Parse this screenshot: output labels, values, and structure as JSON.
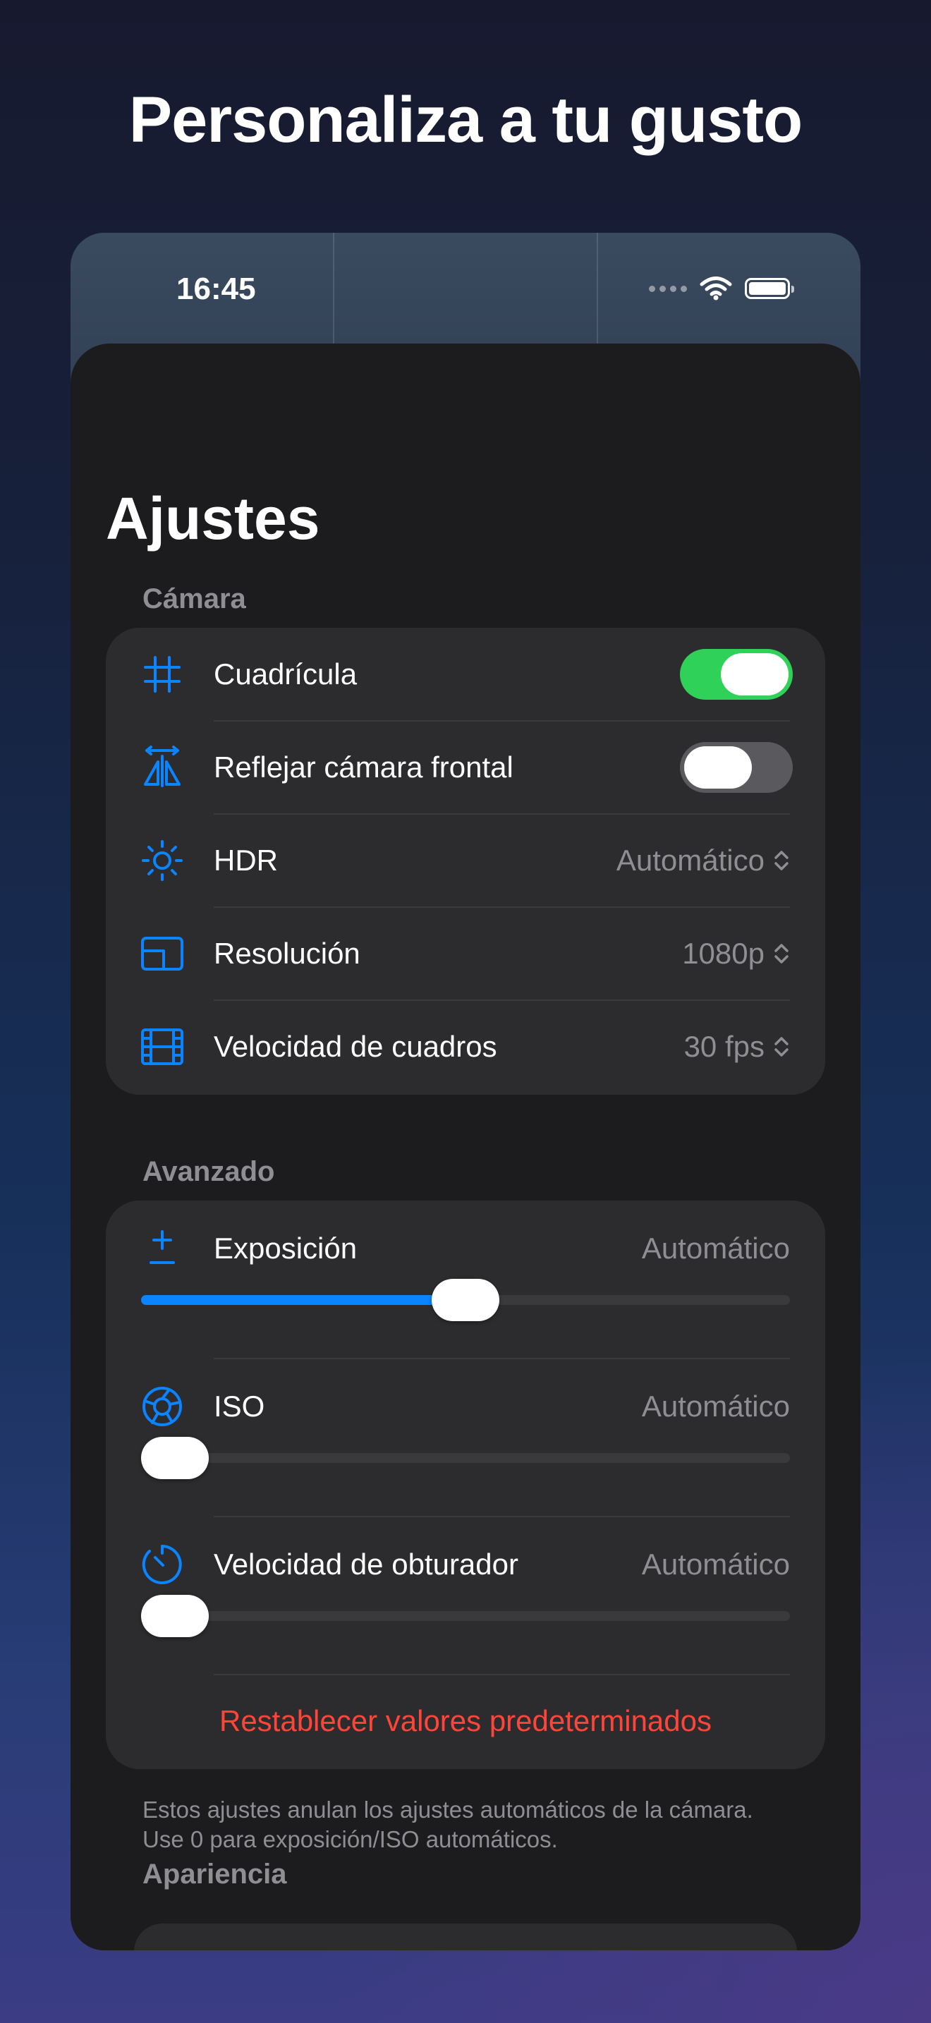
{
  "headline": "Personaliza a tu gusto",
  "status_bar": {
    "time": "16:45"
  },
  "page_title": "Ajustes",
  "sections": {
    "camera": {
      "label": "Cámara",
      "grid": {
        "label": "Cuadrícula",
        "on": true
      },
      "mirror": {
        "label": "Reflejar cámara frontal",
        "on": false
      },
      "hdr": {
        "label": "HDR",
        "value": "Automático"
      },
      "resolution": {
        "label": "Resolución",
        "value": "1080p"
      },
      "framerate": {
        "label": "Velocidad de cuadros",
        "value": "30 fps"
      }
    },
    "advanced": {
      "label": "Avanzado",
      "exposure": {
        "label": "Exposición",
        "value": "Automático",
        "level": 0.5
      },
      "iso": {
        "label": "ISO",
        "value": "Automático",
        "level": 0.0
      },
      "shutter": {
        "label": "Velocidad de obturador",
        "value": "Automático",
        "level": 0.0
      },
      "reset_label": "Restablecer valores predeterminados",
      "footnote_line1": "Estos ajustes anulan los ajustes automáticos de la cámara.",
      "footnote_line2": "Use 0 para exposición/ISO automáticos."
    },
    "appearance": {
      "label": "Apariencia"
    }
  },
  "colors": {
    "accent": "#0a84ff",
    "toggle_on": "#30d158",
    "destructive": "#ff453a",
    "secondary_text": "#8e8e93",
    "card": "#2c2c2e",
    "sheet": "#1c1c1e"
  }
}
